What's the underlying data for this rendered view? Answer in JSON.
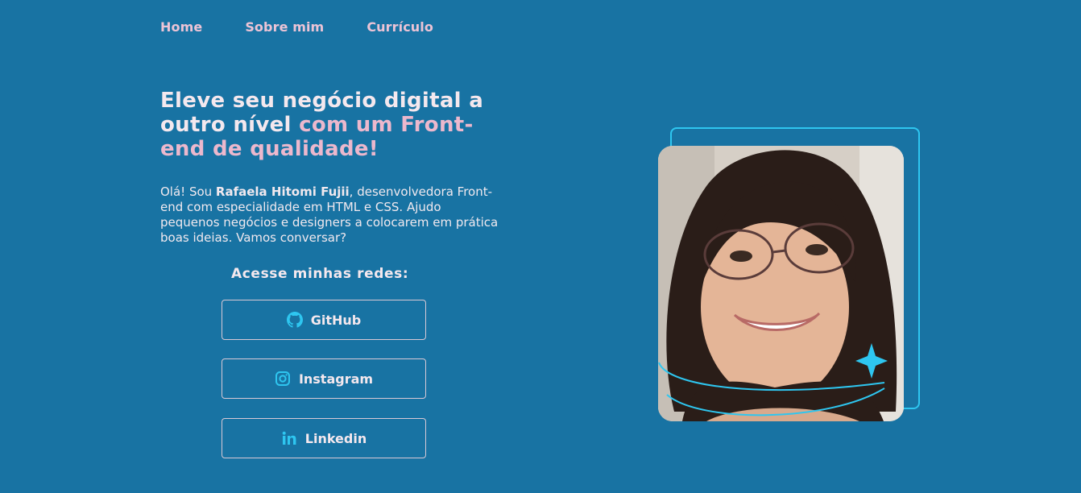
{
  "nav": {
    "items": [
      {
        "label": "Home"
      },
      {
        "label": "Sobre mim"
      },
      {
        "label": "Currículo"
      }
    ]
  },
  "hero": {
    "title_part1": "Eleve seu negócio digital a outro nível ",
    "title_part2": "com um Front-end de qualidade!",
    "intro_pre": "Olá! Sou ",
    "intro_name": "Rafaela Hitomi Fujii",
    "intro_post": ", desenvolvedora Front-end com especialidade em HTML e CSS. Ajudo pequenos negócios e designers a colocarem em prática boas ideias. Vamos conversar?"
  },
  "socials": {
    "title": "Acesse minhas redes:",
    "github_label": "GitHub",
    "instagram_label": "Instagram",
    "linkedin_label": "Linkedin"
  },
  "colors": {
    "background": "#1873a3",
    "accent_pink": "#ecb8cd",
    "accent_cyan": "#2ec6f0"
  },
  "icons": {
    "github": "github-icon",
    "instagram": "instagram-icon",
    "linkedin": "linkedin-icon",
    "sparkle": "sparkle-icon"
  }
}
